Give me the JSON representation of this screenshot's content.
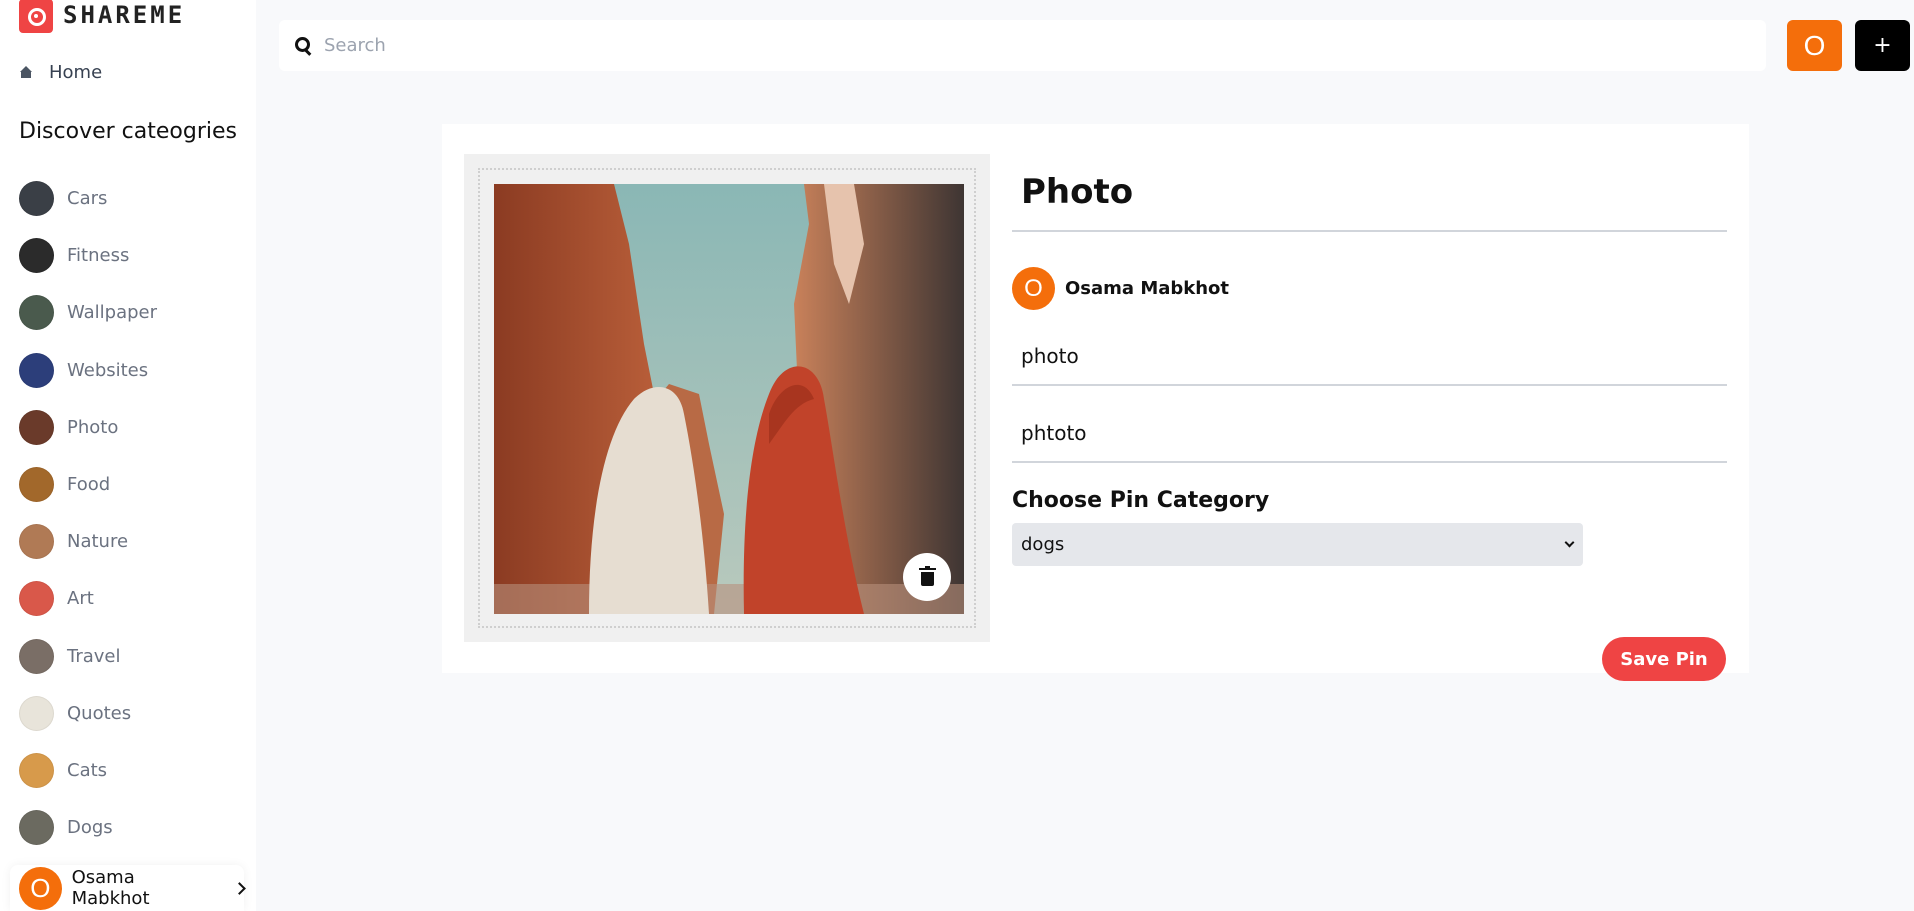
{
  "app": {
    "logo_text": "SHAREME"
  },
  "sidebar": {
    "home_label": "Home",
    "discover_title": "Discover cateogries",
    "categories": [
      {
        "label": "Cars",
        "color": "#3a3f46"
      },
      {
        "label": "Fitness",
        "color": "#2b2b2b"
      },
      {
        "label": "Wallpaper",
        "color": "#4a5a4d"
      },
      {
        "label": "Websites",
        "color": "#2c3e7a"
      },
      {
        "label": "Photo",
        "color": "#6a3a2a"
      },
      {
        "label": "Food",
        "color": "#a2682b"
      },
      {
        "label": "Nature",
        "color": "#b07a55"
      },
      {
        "label": "Art",
        "color": "#d9584a"
      },
      {
        "label": "Travel",
        "color": "#7a6e66"
      },
      {
        "label": "Quotes",
        "color": "#e8e4da"
      },
      {
        "label": "Cats",
        "color": "#d79a4b"
      },
      {
        "label": "Dogs",
        "color": "#6b6a60"
      }
    ],
    "user": {
      "initial": "O",
      "name": "Osama Mabkhot"
    }
  },
  "topbar": {
    "search_placeholder": "Search",
    "avatar_initial": "O",
    "add_label": "+"
  },
  "pin_form": {
    "title": "Photo",
    "author": {
      "initial": "O",
      "name": "Osama Mabkhot"
    },
    "about": "photo",
    "destination": "phtoto",
    "category_heading": "Choose Pin Category",
    "category_selected": "dogs",
    "save_label": "Save Pin"
  },
  "colors": {
    "accent_red": "#ef4444",
    "avatar_orange": "#f46e0b",
    "dark": "#000000"
  }
}
